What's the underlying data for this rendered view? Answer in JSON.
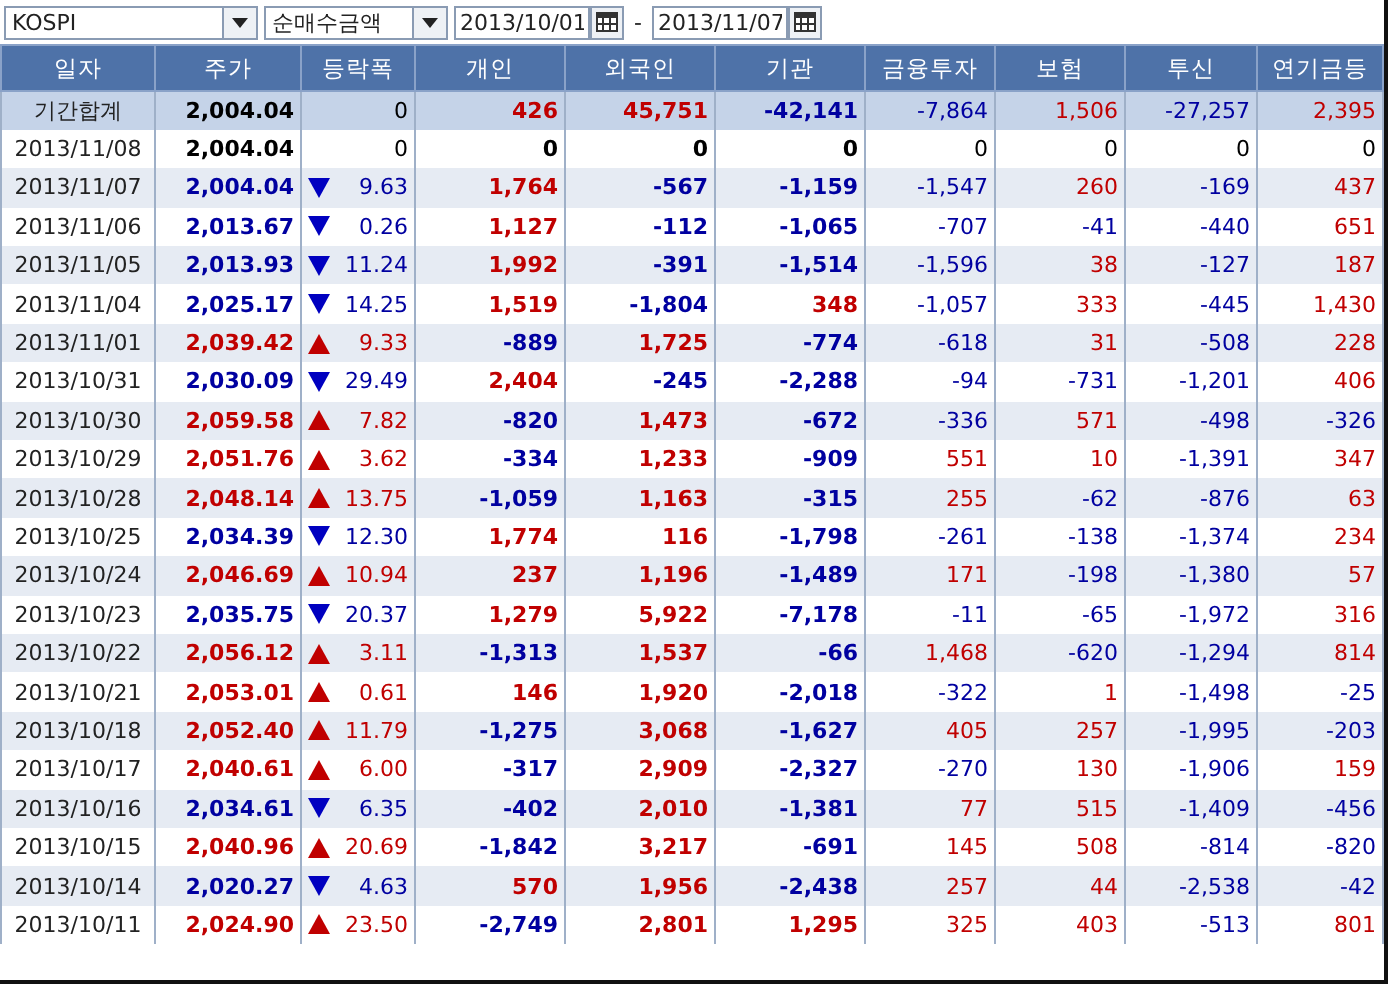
{
  "toolbar": {
    "market": "KOSPI",
    "measure": "순매수금액",
    "date_from": "2013/10/01",
    "separator": "-",
    "date_to": "2013/11/07"
  },
  "table": {
    "columns": [
      "일자",
      "주가",
      "등락폭",
      "개인",
      "외국인",
      "기관",
      "금융투자",
      "보험",
      "투신",
      "연기금등"
    ],
    "rows": [
      {
        "kind": "summary",
        "date": "기간합계",
        "price": "2,004.04",
        "rising": false,
        "falling": false,
        "change": "0",
        "values": [
          "426",
          "45,751",
          "-42,141",
          "-7,864",
          "1,506",
          "-27,257",
          "2,395"
        ]
      },
      {
        "kind": "day",
        "date": "2013/11/08",
        "price": "2,004.04",
        "rising": false,
        "falling": false,
        "change": "0",
        "values": [
          "0",
          "0",
          "0",
          "0",
          "0",
          "0",
          "0"
        ]
      },
      {
        "kind": "day",
        "date": "2013/11/07",
        "price": "2,004.04",
        "rising": false,
        "falling": true,
        "change": "9.63",
        "values": [
          "1,764",
          "-567",
          "-1,159",
          "-1,547",
          "260",
          "-169",
          "437"
        ]
      },
      {
        "kind": "day",
        "date": "2013/11/06",
        "price": "2,013.67",
        "rising": false,
        "falling": true,
        "change": "0.26",
        "values": [
          "1,127",
          "-112",
          "-1,065",
          "-707",
          "-41",
          "-440",
          "651"
        ]
      },
      {
        "kind": "day",
        "date": "2013/11/05",
        "price": "2,013.93",
        "rising": false,
        "falling": true,
        "change": "11.24",
        "values": [
          "1,992",
          "-391",
          "-1,514",
          "-1,596",
          "38",
          "-127",
          "187"
        ]
      },
      {
        "kind": "day",
        "date": "2013/11/04",
        "price": "2,025.17",
        "rising": false,
        "falling": true,
        "change": "14.25",
        "values": [
          "1,519",
          "-1,804",
          "348",
          "-1,057",
          "333",
          "-445",
          "1,430"
        ]
      },
      {
        "kind": "day",
        "date": "2013/11/01",
        "price": "2,039.42",
        "rising": true,
        "falling": false,
        "change": "9.33",
        "values": [
          "-889",
          "1,725",
          "-774",
          "-618",
          "31",
          "-508",
          "228"
        ]
      },
      {
        "kind": "day",
        "date": "2013/10/31",
        "price": "2,030.09",
        "rising": false,
        "falling": true,
        "change": "29.49",
        "values": [
          "2,404",
          "-245",
          "-2,288",
          "-94",
          "-731",
          "-1,201",
          "406"
        ]
      },
      {
        "kind": "day",
        "date": "2013/10/30",
        "price": "2,059.58",
        "rising": true,
        "falling": false,
        "change": "7.82",
        "values": [
          "-820",
          "1,473",
          "-672",
          "-336",
          "571",
          "-498",
          "-326"
        ]
      },
      {
        "kind": "day",
        "date": "2013/10/29",
        "price": "2,051.76",
        "rising": true,
        "falling": false,
        "change": "3.62",
        "values": [
          "-334",
          "1,233",
          "-909",
          "551",
          "10",
          "-1,391",
          "347"
        ]
      },
      {
        "kind": "day",
        "date": "2013/10/28",
        "price": "2,048.14",
        "rising": true,
        "falling": false,
        "change": "13.75",
        "values": [
          "-1,059",
          "1,163",
          "-315",
          "255",
          "-62",
          "-876",
          "63"
        ]
      },
      {
        "kind": "day",
        "date": "2013/10/25",
        "price": "2,034.39",
        "rising": false,
        "falling": true,
        "change": "12.30",
        "values": [
          "1,774",
          "116",
          "-1,798",
          "-261",
          "-138",
          "-1,374",
          "234"
        ]
      },
      {
        "kind": "day",
        "date": "2013/10/24",
        "price": "2,046.69",
        "rising": true,
        "falling": false,
        "change": "10.94",
        "values": [
          "237",
          "1,196",
          "-1,489",
          "171",
          "-198",
          "-1,380",
          "57"
        ]
      },
      {
        "kind": "day",
        "date": "2013/10/23",
        "price": "2,035.75",
        "rising": false,
        "falling": true,
        "change": "20.37",
        "values": [
          "1,279",
          "5,922",
          "-7,178",
          "-11",
          "-65",
          "-1,972",
          "316"
        ]
      },
      {
        "kind": "day",
        "date": "2013/10/22",
        "price": "2,056.12",
        "rising": true,
        "falling": false,
        "change": "3.11",
        "values": [
          "-1,313",
          "1,537",
          "-66",
          "1,468",
          "-620",
          "-1,294",
          "814"
        ]
      },
      {
        "kind": "day",
        "date": "2013/10/21",
        "price": "2,053.01",
        "rising": true,
        "falling": false,
        "change": "0.61",
        "values": [
          "146",
          "1,920",
          "-2,018",
          "-322",
          "1",
          "-1,498",
          "-25"
        ]
      },
      {
        "kind": "day",
        "date": "2013/10/18",
        "price": "2,052.40",
        "rising": true,
        "falling": false,
        "change": "11.79",
        "values": [
          "-1,275",
          "3,068",
          "-1,627",
          "405",
          "257",
          "-1,995",
          "-203"
        ]
      },
      {
        "kind": "day",
        "date": "2013/10/17",
        "price": "2,040.61",
        "rising": true,
        "falling": false,
        "change": "6.00",
        "values": [
          "-317",
          "2,909",
          "-2,327",
          "-270",
          "130",
          "-1,906",
          "159"
        ]
      },
      {
        "kind": "day",
        "date": "2013/10/16",
        "price": "2,034.61",
        "rising": false,
        "falling": true,
        "change": "6.35",
        "values": [
          "-402",
          "2,010",
          "-1,381",
          "77",
          "515",
          "-1,409",
          "-456"
        ]
      },
      {
        "kind": "day",
        "date": "2013/10/15",
        "price": "2,040.96",
        "rising": true,
        "falling": false,
        "change": "20.69",
        "values": [
          "-1,842",
          "3,217",
          "-691",
          "145",
          "508",
          "-814",
          "-820"
        ]
      },
      {
        "kind": "day",
        "date": "2013/10/14",
        "price": "2,020.27",
        "rising": false,
        "falling": true,
        "change": "4.63",
        "values": [
          "570",
          "1,956",
          "-2,438",
          "257",
          "44",
          "-2,538",
          "-42"
        ]
      },
      {
        "kind": "day",
        "date": "2013/10/11",
        "price": "2,024.90",
        "rising": true,
        "falling": false,
        "change": "23.50",
        "values": [
          "-2,749",
          "2,801",
          "1,295",
          "325",
          "403",
          "-513",
          "801"
        ]
      }
    ]
  }
}
